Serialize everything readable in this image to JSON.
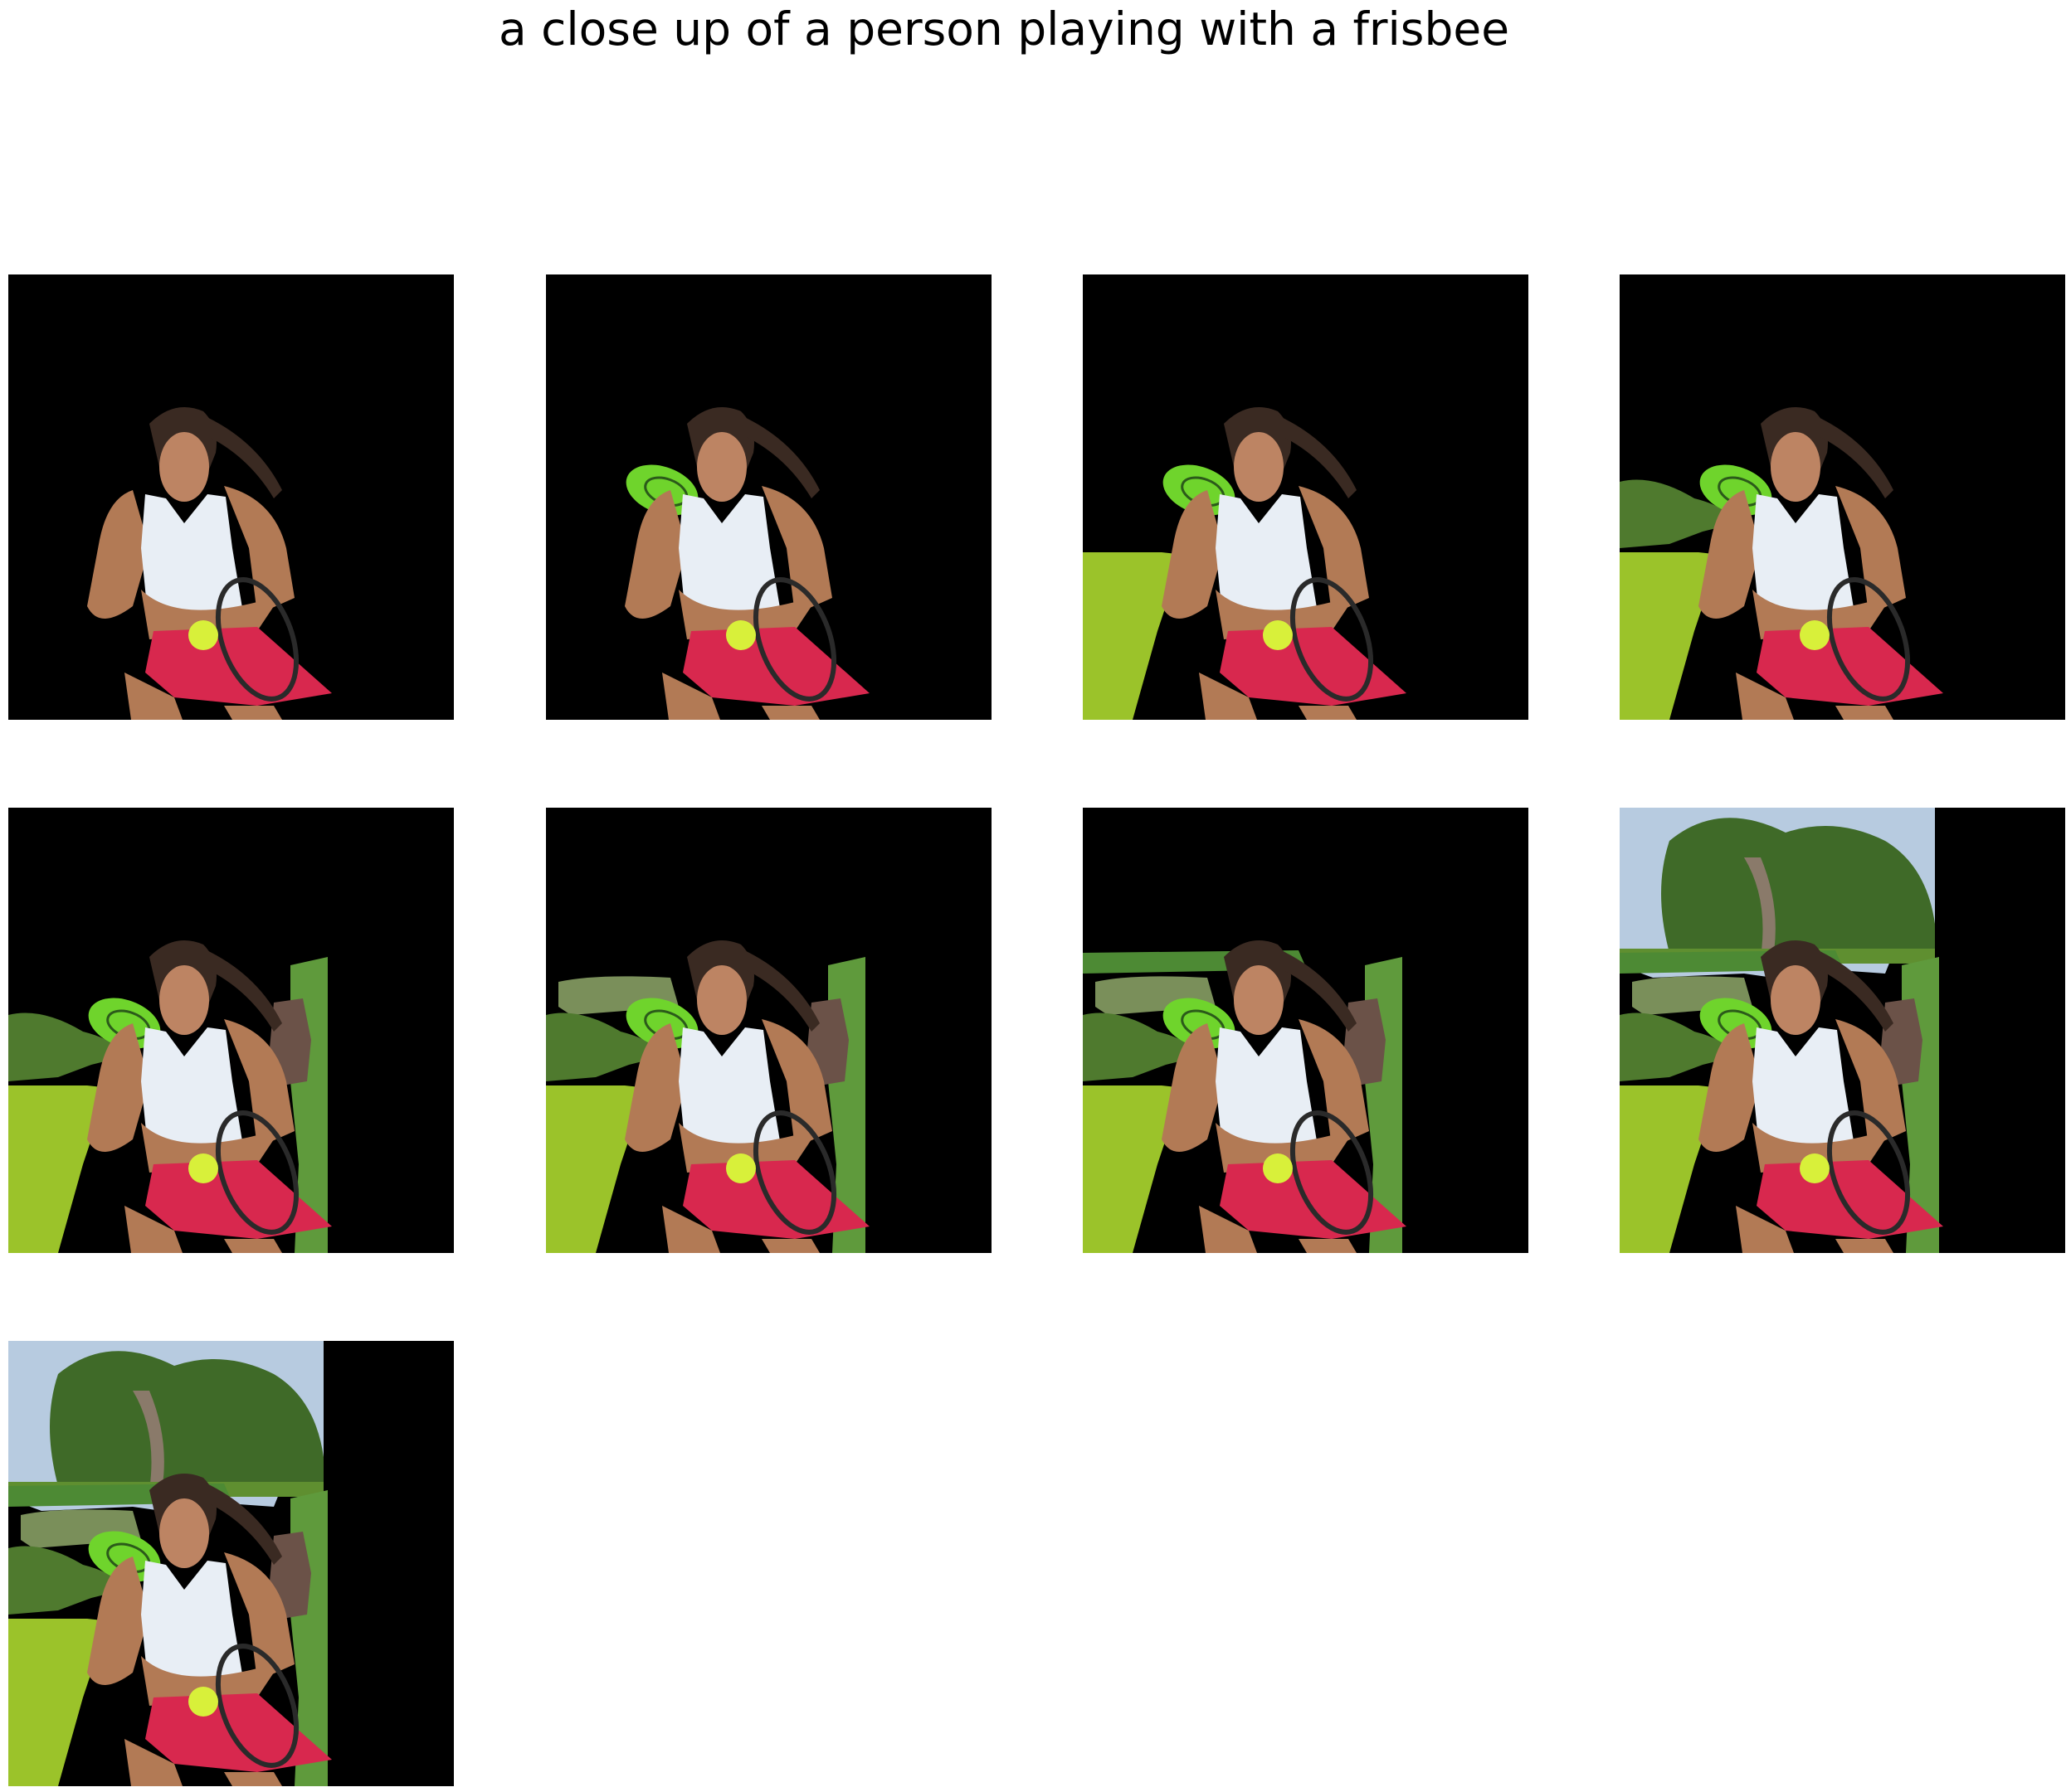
{
  "figure": {
    "title": "a close up of a person playing with a frisbee"
  },
  "panels": [
    {
      "id": 1,
      "layers": []
    },
    {
      "id": 2,
      "layers": [
        "frisbee"
      ]
    },
    {
      "id": 3,
      "layers": [
        "frisbee",
        "grass"
      ]
    },
    {
      "id": 4,
      "layers": [
        "frisbee",
        "grass",
        "bush-left"
      ]
    },
    {
      "id": 5,
      "layers": [
        "frisbee",
        "grass",
        "bush-left",
        "plant-right",
        "barrel"
      ]
    },
    {
      "id": 6,
      "layers": [
        "frisbee",
        "grass",
        "bush-left",
        "plant-right",
        "barrel",
        "field-strip"
      ]
    },
    {
      "id": 7,
      "layers": [
        "frisbee",
        "grass",
        "bush-left",
        "plant-right",
        "barrel",
        "field-strip",
        "hedge-top"
      ]
    },
    {
      "id": 8,
      "layers": [
        "frisbee",
        "grass",
        "bush-left",
        "plant-right",
        "barrel",
        "field-strip",
        "hedge-top",
        "trees"
      ]
    },
    {
      "id": 9,
      "layers": [
        "frisbee",
        "grass",
        "bush-left",
        "plant-right",
        "barrel",
        "field-strip",
        "hedge-top",
        "trees"
      ]
    }
  ],
  "colors": {
    "background": "#000000",
    "grass": "#9bc32a",
    "frisbee": "#6fd42c",
    "skin": "#b27a55",
    "shirt": "#e8eef5",
    "skirt": "#d8284e",
    "ball": "#d8f03a",
    "hair": "#3a2a22",
    "foliage": "#4f7a2e",
    "barrel": "#6b5248",
    "sky": "#b7cbe0"
  }
}
